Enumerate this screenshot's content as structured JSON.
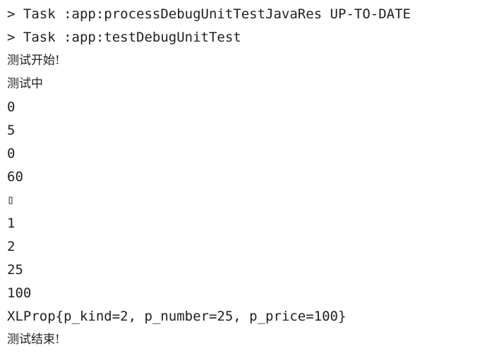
{
  "console": {
    "lines": [
      "> Task :app:processDebugUnitTestJavaRes UP-TO-DATE",
      "> Task :app:testDebugUnitTest",
      "测试开始!",
      "测试中",
      "0",
      "5",
      "0",
      "60",
      "▯",
      "1",
      "2",
      "25",
      "100",
      "XLProp{p_kind=2, p_number=25, p_price=100}",
      "测试结束!"
    ]
  }
}
